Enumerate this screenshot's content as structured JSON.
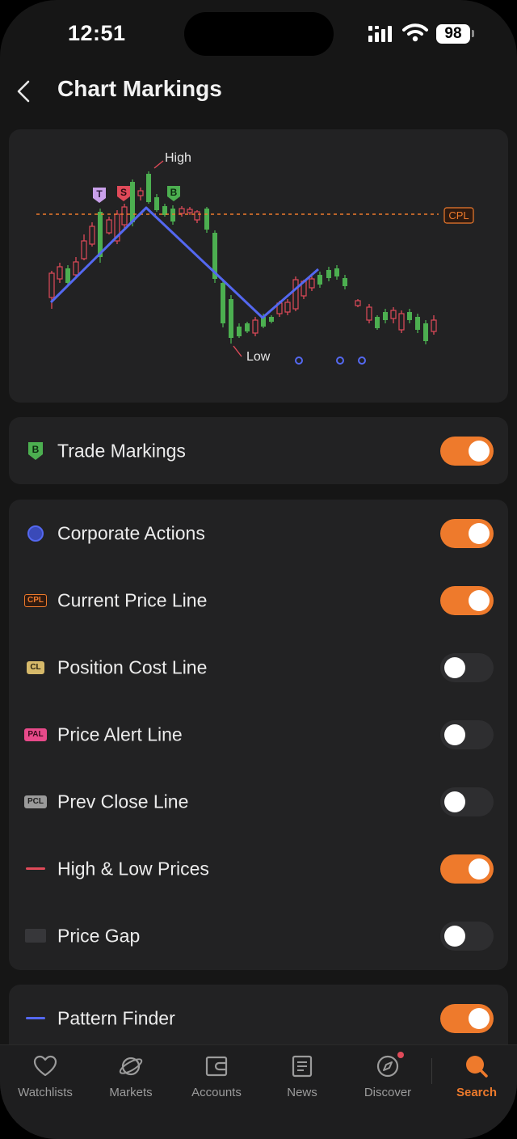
{
  "status_bar": {
    "time": "12:51",
    "battery": "98"
  },
  "header": {
    "title": "Chart Markings",
    "back_icon": "chevron-left-icon"
  },
  "chart_preview": {
    "high_label": "High",
    "low_label": "Low",
    "cpl_tag": "CPL",
    "trade_tags": [
      "T",
      "S",
      "B"
    ]
  },
  "trade_section": {
    "items": [
      {
        "label": "Trade Markings",
        "icon": "buy-badge-icon",
        "enabled": true
      }
    ]
  },
  "markings_section": {
    "tags": {
      "cpl": "CPL",
      "cl": "CL",
      "pal": "PAL",
      "pcl": "PCL"
    },
    "items": [
      {
        "label": "Corporate Actions",
        "icon": "corporate-action-dot-icon",
        "enabled": true
      },
      {
        "label": "Current Price Line",
        "icon": "cpl-tag-icon",
        "enabled": true
      },
      {
        "label": "Position Cost Line",
        "icon": "cl-tag-icon",
        "enabled": false
      },
      {
        "label": "Price Alert Line",
        "icon": "pal-tag-icon",
        "enabled": false
      },
      {
        "label": "Prev Close Line",
        "icon": "pcl-tag-icon",
        "enabled": false
      },
      {
        "label": "High & Low Prices",
        "icon": "red-line-icon",
        "enabled": true
      },
      {
        "label": "Price Gap",
        "icon": "gray-block-icon",
        "enabled": false
      }
    ]
  },
  "pattern_section": {
    "items": [
      {
        "label": "Pattern Finder",
        "icon": "blue-line-icon",
        "enabled": true
      }
    ]
  },
  "colors": {
    "accent": "#ee7a2c",
    "up": "#4caf50",
    "down": "#e04a59",
    "pattern": "#5468f0"
  },
  "bottom_nav": {
    "items": [
      {
        "label": "Watchlists",
        "icon": "heart-icon",
        "active": false
      },
      {
        "label": "Markets",
        "icon": "planet-icon",
        "active": false
      },
      {
        "label": "Accounts",
        "icon": "wallet-icon",
        "active": false
      },
      {
        "label": "News",
        "icon": "news-icon",
        "active": false
      },
      {
        "label": "Discover",
        "icon": "compass-icon",
        "active": false,
        "badge": true
      },
      {
        "label": "Search",
        "icon": "search-icon",
        "active": true
      }
    ]
  }
}
